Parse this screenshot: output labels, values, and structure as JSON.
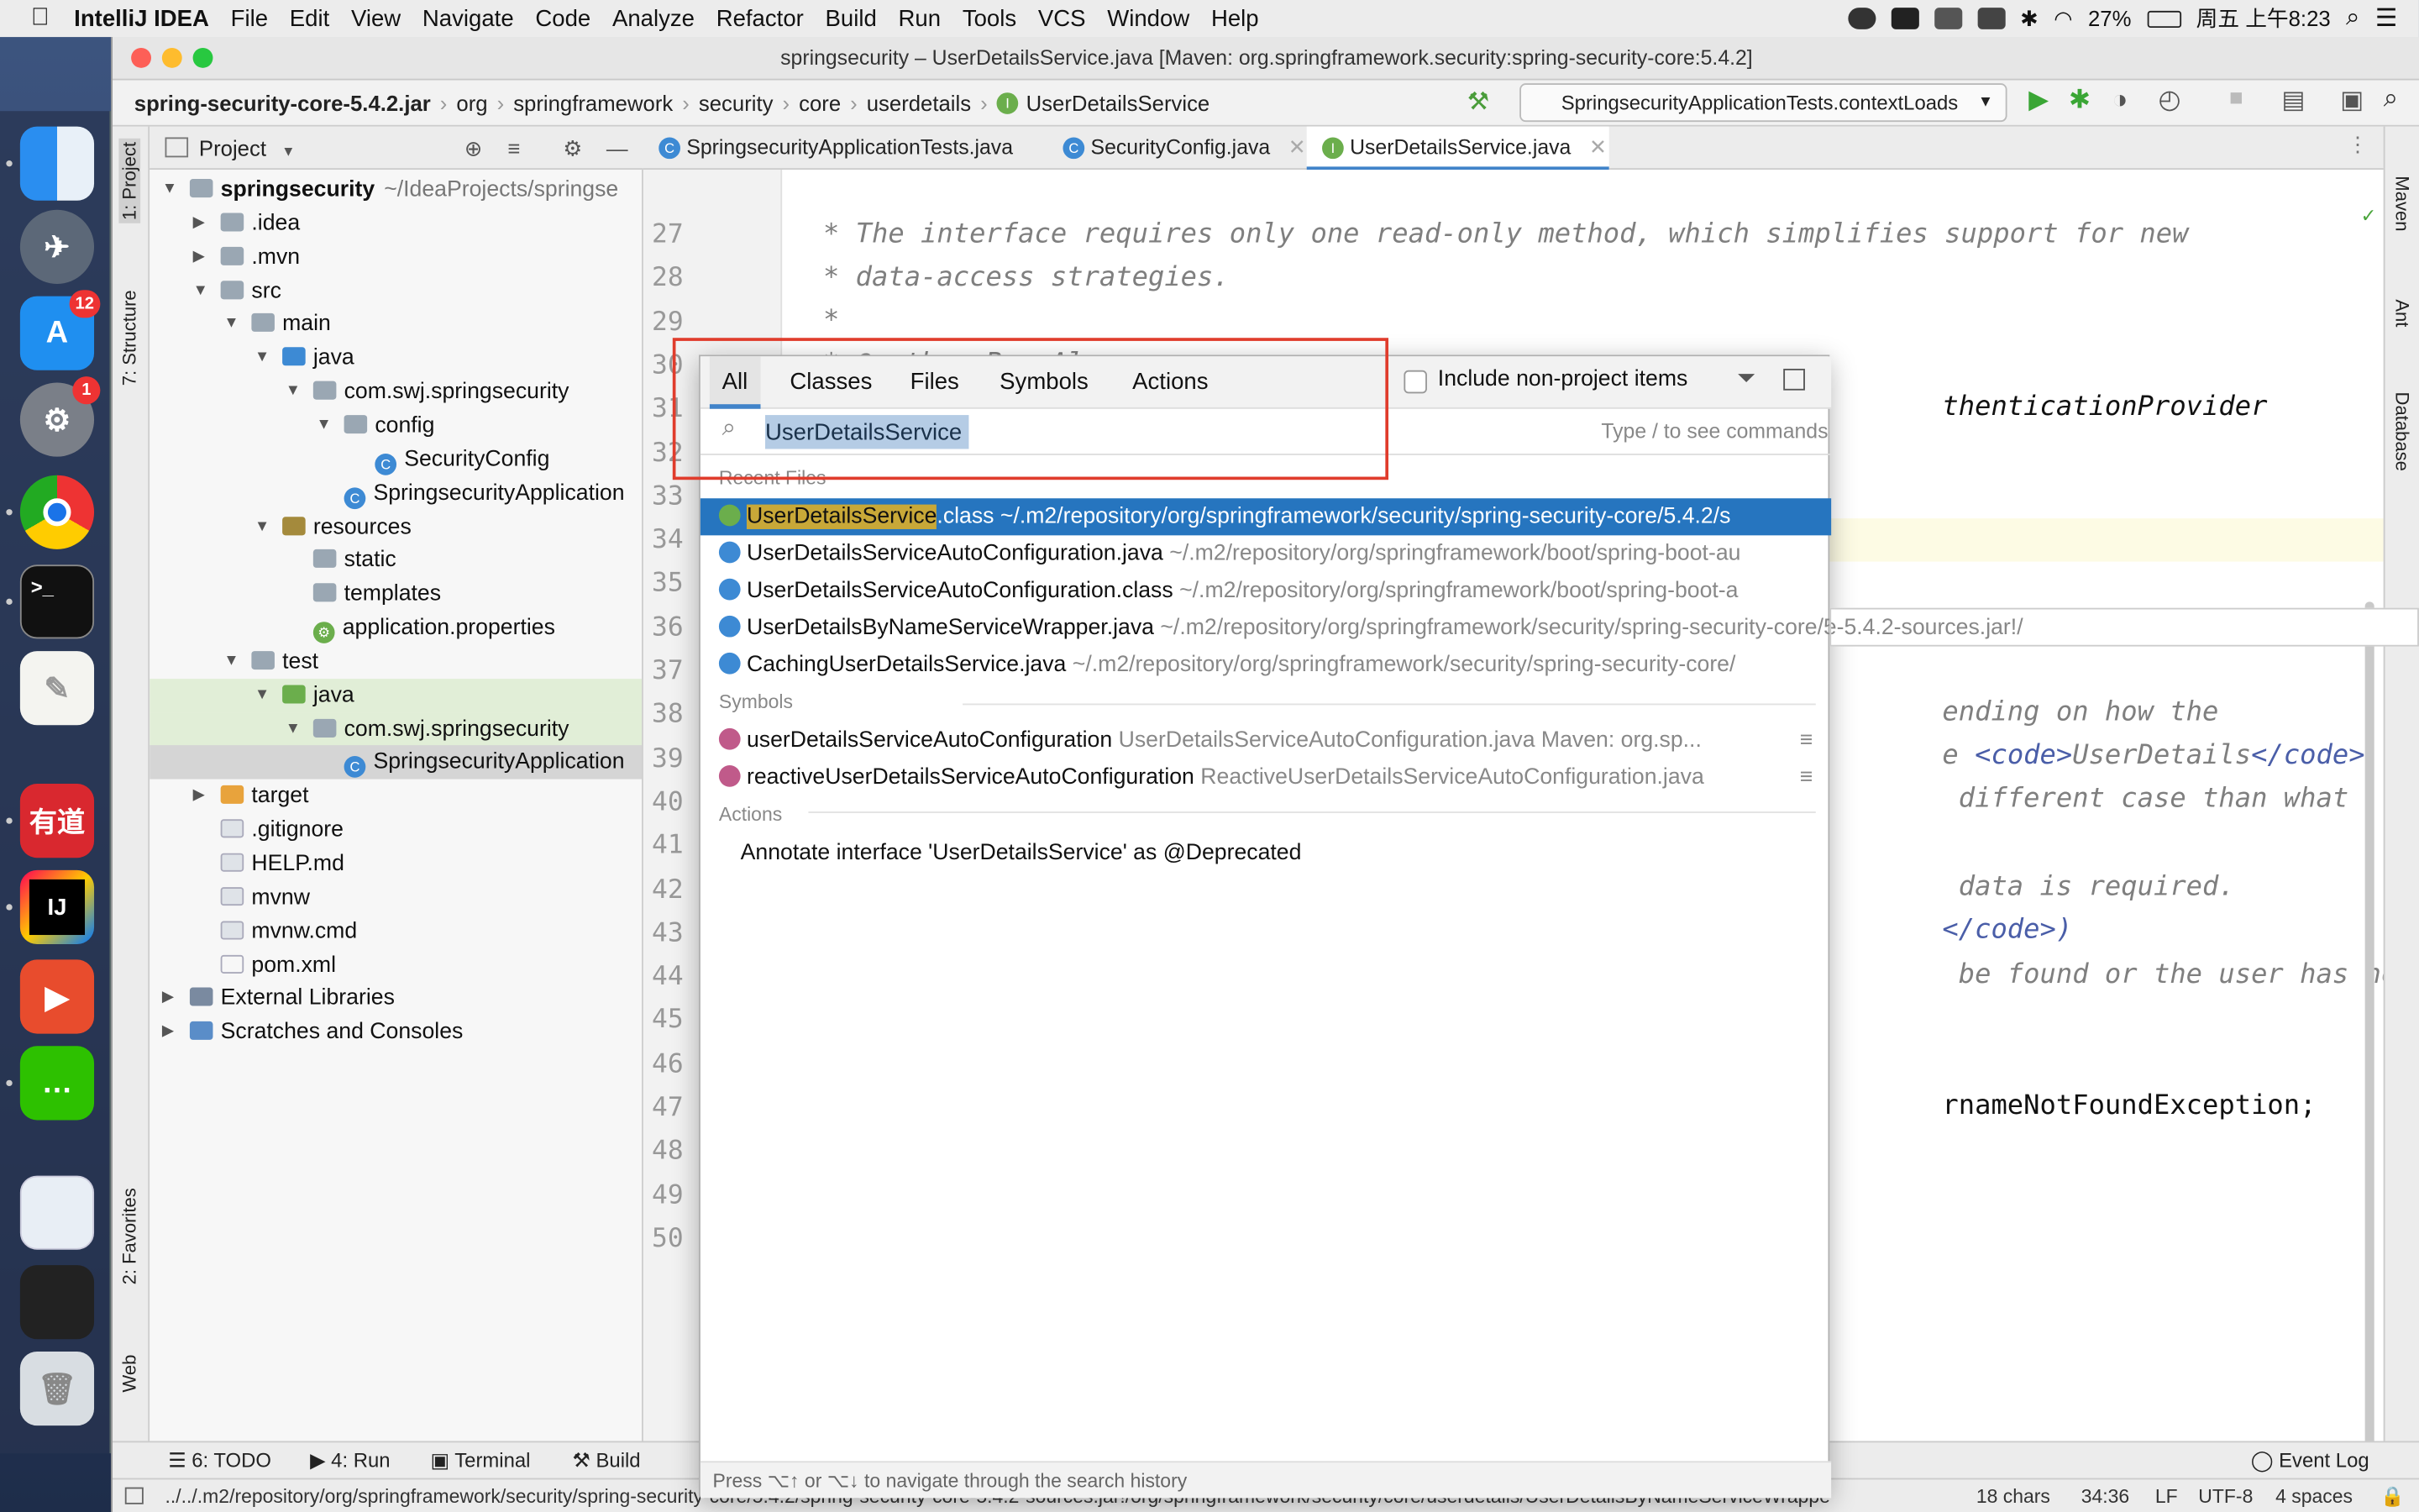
{
  "menubar": {
    "app": "IntelliJ IDEA",
    "items": [
      "File",
      "Edit",
      "View",
      "Navigate",
      "Code",
      "Analyze",
      "Refactor",
      "Build",
      "Run",
      "Tools",
      "VCS",
      "Window",
      "Help"
    ],
    "battery": "27%",
    "clock": "周五 上午8:23"
  },
  "dock": {
    "badge_appstore": "12",
    "badge_settings": "1",
    "youdao_label": "有道",
    "ij_label": "IJ"
  },
  "window": {
    "title": "springsecurity – UserDetailsService.java [Maven: org.springframework.security:spring-security-core:5.4.2]",
    "breadcrumb": [
      "spring-security-core-5.4.2.jar",
      "org",
      "springframework",
      "security",
      "core",
      "userdetails",
      "UserDetailsService"
    ],
    "run_config": "SpringsecurityApplicationTests.contextLoads"
  },
  "project_panel": {
    "title": "Project",
    "tree": [
      {
        "label": "springsecurity",
        "suffix": "~/IdeaProjects/springse",
        "depth": 0,
        "arrow": "down",
        "icon": "module"
      },
      {
        "label": ".idea",
        "depth": 1,
        "arrow": "right",
        "icon": "folder"
      },
      {
        "label": ".mvn",
        "depth": 1,
        "arrow": "right",
        "icon": "folder"
      },
      {
        "label": "src",
        "depth": 1,
        "arrow": "down",
        "icon": "folder"
      },
      {
        "label": "main",
        "depth": 2,
        "arrow": "down",
        "icon": "folder"
      },
      {
        "label": "java",
        "depth": 3,
        "arrow": "down",
        "icon": "src"
      },
      {
        "label": "com.swj.springsecurity",
        "depth": 4,
        "arrow": "down",
        "icon": "package"
      },
      {
        "label": "config",
        "depth": 5,
        "arrow": "down",
        "icon": "package"
      },
      {
        "label": "SecurityConfig",
        "depth": 6,
        "arrow": "",
        "icon": "class"
      },
      {
        "label": "SpringsecurityApplication",
        "depth": 5,
        "arrow": "",
        "icon": "class"
      },
      {
        "label": "resources",
        "depth": 3,
        "arrow": "down",
        "icon": "res"
      },
      {
        "label": "static",
        "depth": 4,
        "arrow": "",
        "icon": "folder"
      },
      {
        "label": "templates",
        "depth": 4,
        "arrow": "",
        "icon": "folder"
      },
      {
        "label": "application.properties",
        "depth": 4,
        "arrow": "",
        "icon": "props"
      },
      {
        "label": "test",
        "depth": 2,
        "arrow": "down",
        "icon": "folder"
      },
      {
        "label": "java",
        "depth": 3,
        "arrow": "down",
        "icon": "test"
      },
      {
        "label": "com.swj.springsecurity",
        "depth": 4,
        "arrow": "down",
        "icon": "package"
      },
      {
        "label": "SpringsecurityApplication",
        "depth": 5,
        "arrow": "",
        "icon": "class"
      },
      {
        "label": "target",
        "depth": 1,
        "arrow": "right",
        "icon": "target"
      },
      {
        "label": ".gitignore",
        "depth": 1,
        "arrow": "",
        "icon": "file"
      },
      {
        "label": "HELP.md",
        "depth": 1,
        "arrow": "",
        "icon": "md"
      },
      {
        "label": "mvnw",
        "depth": 1,
        "arrow": "",
        "icon": "file"
      },
      {
        "label": "mvnw.cmd",
        "depth": 1,
        "arrow": "",
        "icon": "file"
      },
      {
        "label": "pom.xml",
        "depth": 1,
        "arrow": "",
        "icon": "maven"
      },
      {
        "label": "External Libraries",
        "depth": 0,
        "arrow": "right",
        "icon": "lib"
      },
      {
        "label": "Scratches and Consoles",
        "depth": 0,
        "arrow": "right",
        "icon": "scratch"
      }
    ]
  },
  "tabs": [
    {
      "label": "SpringsecurityApplicationTests.java",
      "active": false
    },
    {
      "label": "SecurityConfig.java",
      "active": false
    },
    {
      "label": "UserDetailsService.java",
      "active": true
    }
  ],
  "left_stripe": {
    "project": "1: Project",
    "structure": "7: Structure",
    "favorites": "2: Favorites",
    "web": "Web"
  },
  "right_stripe": {
    "maven": "Maven",
    "ant": "Ant",
    "database": "Database"
  },
  "editor": {
    "line_numbers": [
      "27",
      "28",
      "29",
      "30",
      "31",
      "32",
      "33",
      "34",
      "35",
      "36",
      "37",
      "38",
      "39",
      "40",
      "41",
      "42",
      "43",
      "44",
      "45",
      "46",
      "47",
      "48",
      "49",
      "50"
    ],
    "line27": " * The interface requires only one read-only method, which simplifies support for new",
    "line28": " * data-access strategies.",
    "line29": " *",
    "line30": " * @author Ben Alex",
    "line31_tail": "thenticationProvider",
    "line38_tail": "ending on how the",
    "line39_pre": "e ",
    "line39_tag1": "<code>",
    "line39_mid": "UserDetails",
    "line39_tag2": "</code>",
    "line40_tail": " different case than what",
    "line42_tail": " data is required.",
    "line43_tail": "</code>)",
    "line44_tail": " be found or the user has no",
    "line47_tail": "rnameNotFoundException;"
  },
  "search_popup": {
    "tabs": [
      "All",
      "Classes",
      "Files",
      "Symbols",
      "Actions"
    ],
    "include_non_project": "Include non-project items",
    "query": "UserDetailsService",
    "hint": "Type / to see commands",
    "recent_files_header": "Recent Files",
    "recent": [
      {
        "name": "UserDetailsService.class",
        "path": "~/.m2/repository/org/springframework/security/spring-security-core/5.4.2/s",
        "selected": true,
        "icon": "interface"
      },
      {
        "name": "UserDetailsServiceAutoConfiguration.java",
        "path": "~/.m2/repository/org/springframework/boot/spring-boot-au",
        "icon": "class"
      },
      {
        "name": "UserDetailsServiceAutoConfiguration.class",
        "path": "~/.m2/repository/org/springframework/boot/spring-boot-a",
        "icon": "class"
      },
      {
        "name": "UserDetailsByNameServiceWrapper.java",
        "path": "~/.m2/repository/org/springframework/security/spring-security-core/5.4.2/spring-security-core-5.4.2-sources.jar!/",
        "icon": "class"
      },
      {
        "name": "CachingUserDetailsService.java",
        "path": "~/.m2/repository/org/springframework/security/spring-security-core/",
        "icon": "class"
      }
    ],
    "symbols_header": "Symbols",
    "symbols": [
      {
        "name": "userDetailsServiceAutoConfiguration",
        "path": "UserDetailsServiceAutoConfiguration.java  Maven: org.sp..."
      },
      {
        "name": "reactiveUserDetailsServiceAutoConfiguration",
        "path": "ReactiveUserDetailsServiceAutoConfiguration.java"
      }
    ],
    "actions_header": "Actions",
    "action": "Annotate interface 'UserDetailsService' as @Deprecated",
    "footer": "Press ⌥↑ or ⌥↓ to navigate through the search history",
    "overflow_text": "~/.m2/repository/org/springframework/security/spring-security-core/5.4.2/spring-security-core-5.4.2-sources.jar!/"
  },
  "bottom_tools": [
    "6: TODO",
    "4: Run",
    "Terminal",
    "Build"
  ],
  "event_log": "Event Log",
  "status": {
    "path": "../../.m2/repository/org/springframework/security/spring-security-core/5.4.2/spring-security-core-5.4.2-sources.jar!/org/springframework/security/core/userdetails/UserDetailsByNameServiceWrappe",
    "chars": "18 chars",
    "position": "34:36",
    "line_sep": "LF",
    "encoding": "UTF-8",
    "indent": "4 spaces"
  },
  "colors": {
    "accent": "#2675bf",
    "highlight_box": "#e03c2c",
    "selection": "#2675bf"
  }
}
